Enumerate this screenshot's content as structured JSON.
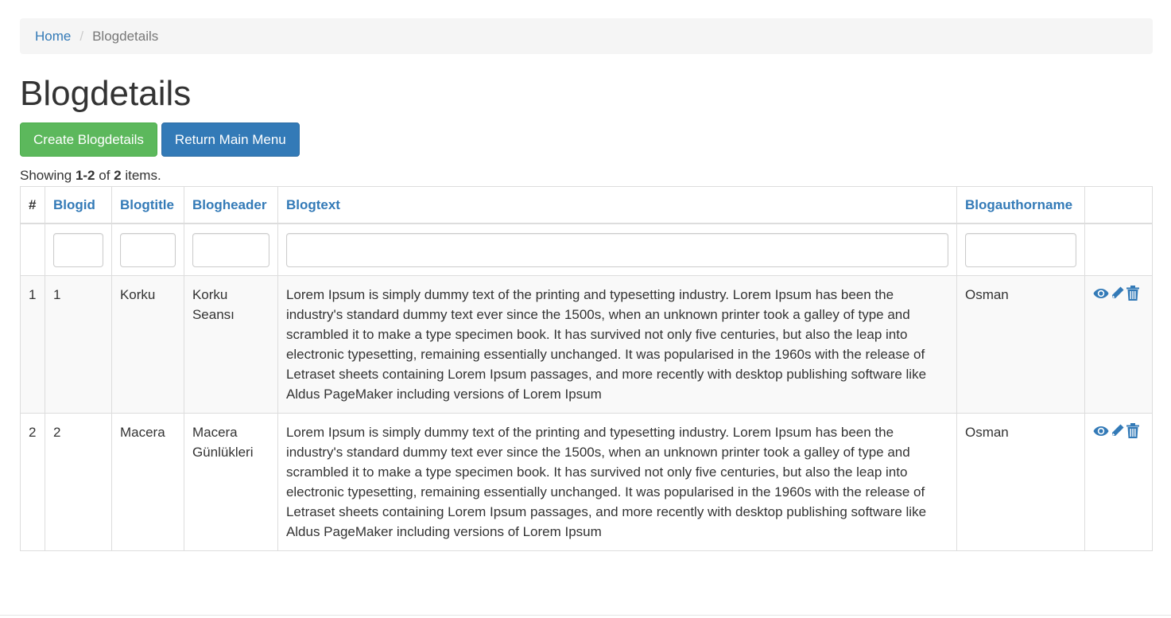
{
  "breadcrumb": {
    "home": "Home",
    "separator": "/",
    "current": "Blogdetails"
  },
  "page_title": "Blogdetails",
  "buttons": {
    "create": "Create Blogdetails",
    "return": "Return Main Menu"
  },
  "summary": {
    "prefix": "Showing ",
    "range": "1-2",
    "middle": " of ",
    "total": "2",
    "suffix": " items."
  },
  "table": {
    "headers": {
      "index": "#",
      "blogid": "Blogid",
      "blogtitle": "Blogtitle",
      "blogheader": "Blogheader",
      "blogtext": "Blogtext",
      "blogauthorname": "Blogauthorname"
    },
    "filters": {
      "blogid": "",
      "blogtitle": "",
      "blogheader": "",
      "blogtext": "",
      "blogauthorname": ""
    },
    "rows": [
      {
        "index": "1",
        "blogid": "1",
        "blogtitle": "Korku",
        "blogheader": "Korku Seansı",
        "blogtext": "Lorem Ipsum is simply dummy text of the printing and typesetting industry. Lorem Ipsum has been the industry's standard dummy text ever since the 1500s, when an unknown printer took a galley of type and scrambled it to make a type specimen book. It has survived not only five centuries, but also the leap into electronic typesetting, remaining essentially unchanged. It was popularised in the 1960s with the release of Letraset sheets containing Lorem Ipsum passages, and more recently with desktop publishing software like Aldus PageMaker including versions of Lorem Ipsum",
        "blogauthorname": "Osman"
      },
      {
        "index": "2",
        "blogid": "2",
        "blogtitle": "Macera",
        "blogheader": "Macera Günlükleri",
        "blogtext": "Lorem Ipsum is simply dummy text of the printing and typesetting industry. Lorem Ipsum has been the industry's standard dummy text ever since the 1500s, when an unknown printer took a galley of type and scrambled it to make a type specimen book. It has survived not only five centuries, but also the leap into electronic typesetting, remaining essentially unchanged. It was popularised in the 1960s with the release of Letraset sheets containing Lorem Ipsum passages, and more recently with desktop publishing software like Aldus PageMaker including versions of Lorem Ipsum",
        "blogauthorname": "Osman"
      }
    ],
    "action_icons": [
      "eye-icon",
      "pencil-icon",
      "trash-icon"
    ]
  },
  "colors": {
    "link": "#337ab7",
    "success": "#5cb85c",
    "primary": "#337ab7",
    "breadcrumb_bg": "#f5f5f5",
    "striped_row": "#f9f9f9"
  }
}
